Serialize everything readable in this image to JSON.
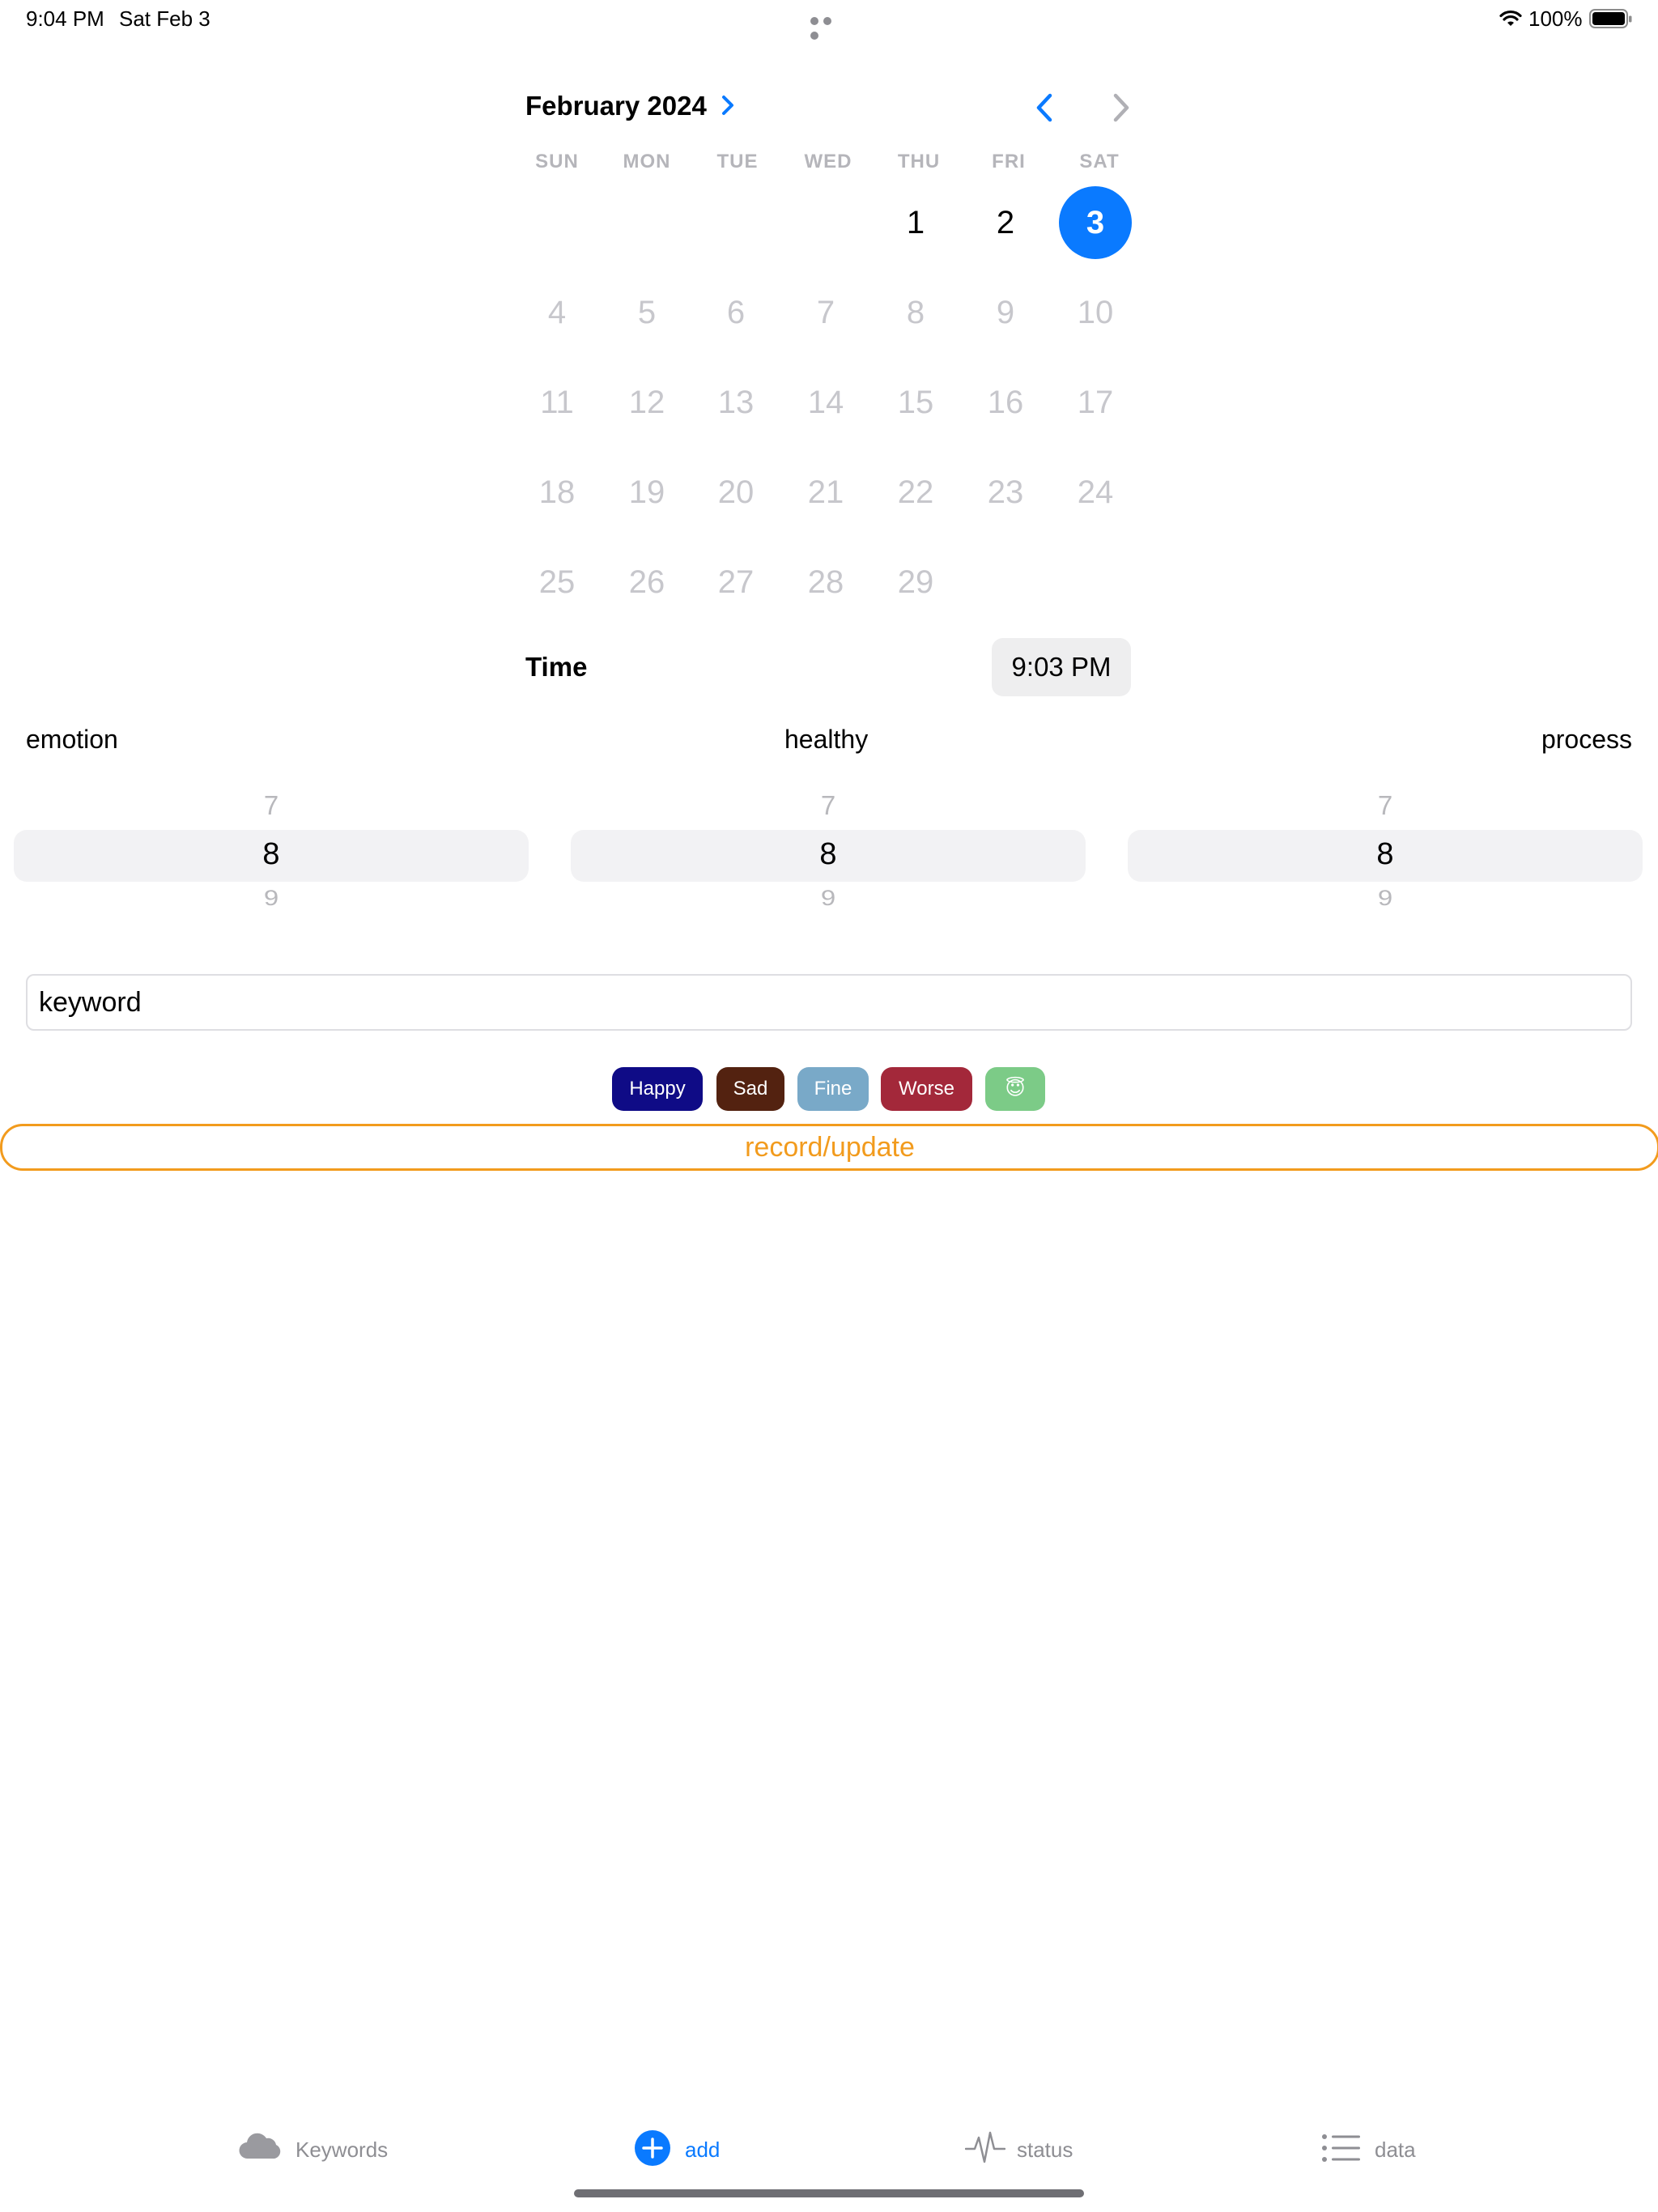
{
  "status_bar": {
    "time": "9:04 PM",
    "date": "Sat Feb 3",
    "battery": "100%"
  },
  "calendar": {
    "month_label": "February 2024",
    "weekdays": [
      "SUN",
      "MON",
      "TUE",
      "WED",
      "THU",
      "FRI",
      "SAT"
    ],
    "days": [
      "1",
      "2",
      "3",
      "4",
      "5",
      "6",
      "7",
      "8",
      "9",
      "10",
      "11",
      "12",
      "13",
      "14",
      "15",
      "16",
      "17",
      "18",
      "19",
      "20",
      "21",
      "22",
      "23",
      "24",
      "25",
      "26",
      "27",
      "28",
      "29"
    ],
    "selected_day": "3",
    "accent_color": "#0a7aff"
  },
  "time_row": {
    "label": "Time",
    "value": "9:03 PM"
  },
  "pickers": [
    {
      "label": "emotion",
      "above": "7",
      "selected": "8",
      "below": "9"
    },
    {
      "label": "healthy",
      "above": "7",
      "selected": "8",
      "below": "9"
    },
    {
      "label": "process",
      "above": "7",
      "selected": "8",
      "below": "9"
    }
  ],
  "keyword_input": {
    "value": "keyword"
  },
  "tags": [
    {
      "label": "Happy",
      "color": "#0f0b86"
    },
    {
      "label": "Sad",
      "color": "#532210"
    },
    {
      "label": "Fine",
      "color": "#79a9c8"
    },
    {
      "label": "Worse",
      "color": "#a3283a"
    },
    {
      "label": "😇",
      "color": "#7ccb87"
    }
  ],
  "record_button": {
    "label": "record/update",
    "color": "#f29b1d"
  },
  "tab_bar": {
    "items": [
      {
        "label": "Keywords",
        "icon": "cloud-icon",
        "active": false
      },
      {
        "label": "add",
        "icon": "plus-circle-icon",
        "active": true
      },
      {
        "label": "status",
        "icon": "waveform-icon",
        "active": false
      },
      {
        "label": "data",
        "icon": "list-icon",
        "active": false
      }
    ]
  }
}
